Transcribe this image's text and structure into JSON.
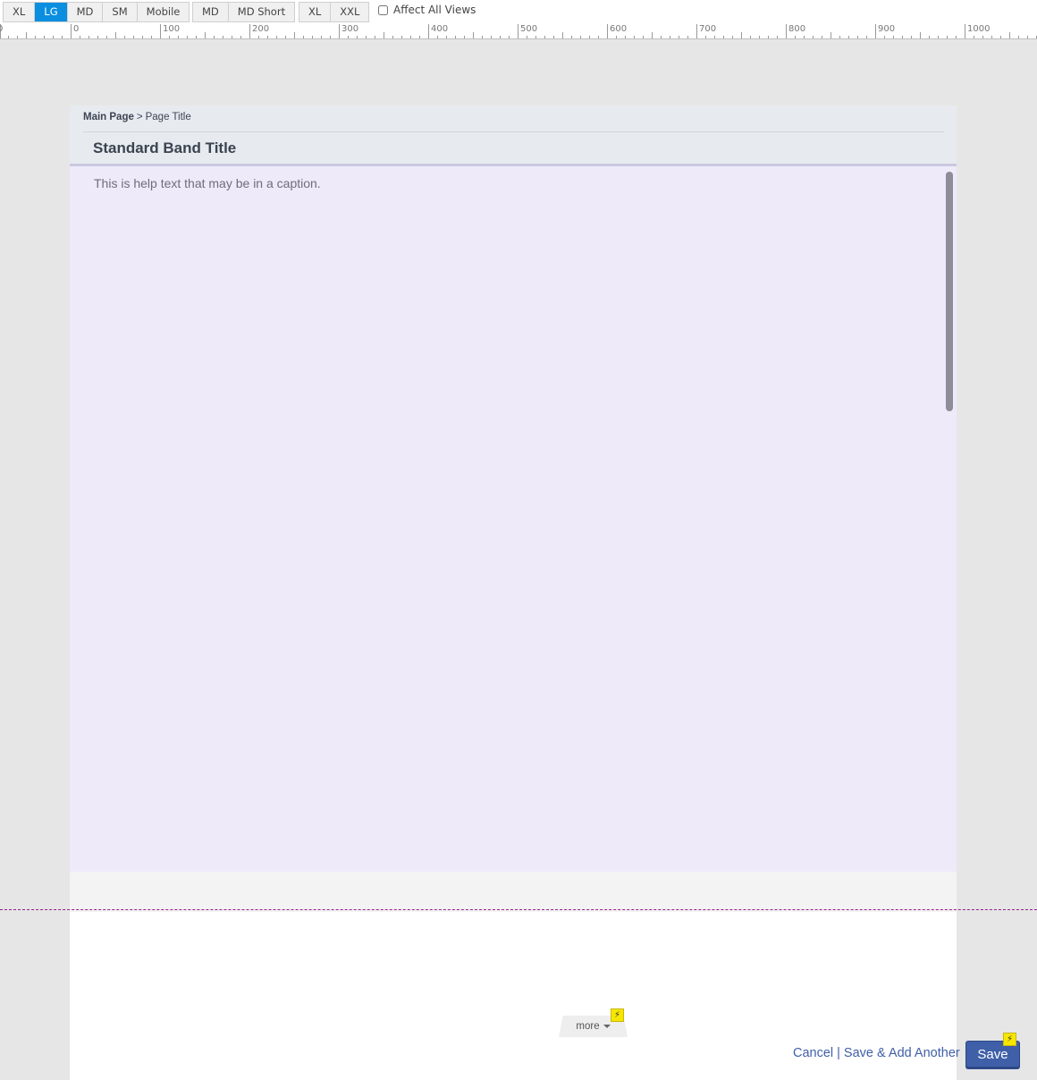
{
  "toolbar": {
    "views_group_a": [
      "XL",
      "LG",
      "MD",
      "SM",
      "Mobile"
    ],
    "active_view": "LG",
    "views_group_b": [
      "MD",
      "MD Short"
    ],
    "views_group_c": [
      "XL",
      "XXL"
    ],
    "affect_all_label": "Affect All Views",
    "affect_all_checked": false
  },
  "ruler": {
    "labels": [
      "0",
      "100",
      "200",
      "300",
      "400",
      "500",
      "600",
      "700",
      "800",
      "900",
      "1000"
    ],
    "left_edge_label": "0"
  },
  "page": {
    "breadcrumb_root": "Main Page",
    "breadcrumb_separator": ">",
    "breadcrumb_current": "Page Title",
    "band_title": "Standard Band Title",
    "help_text": "This is help text that may be in a caption."
  },
  "footer": {
    "more_label": "more",
    "bolt_icon": "lightning-icon",
    "cancel_label": "Cancel",
    "separator": "|",
    "save_add_label": "Save & Add Another",
    "save_label": "Save"
  },
  "colors": {
    "active_view": "#0a8ee0",
    "save_button": "#3f5fa8",
    "content_bg": "#eeeafa",
    "fold_line": "#9a1d8e",
    "bolt": "#f7e600"
  }
}
